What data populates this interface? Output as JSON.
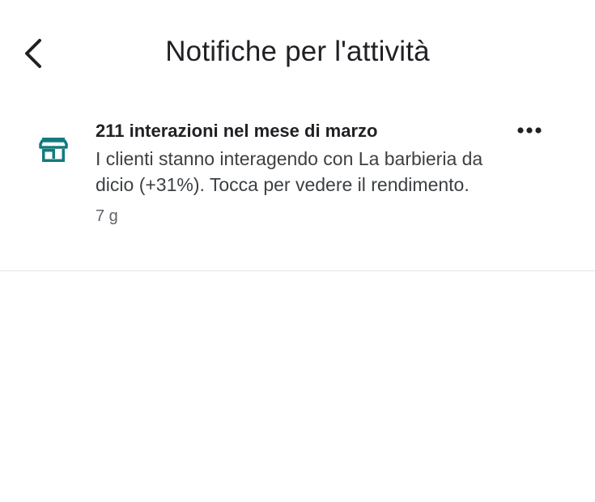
{
  "header": {
    "title": "Notifiche per l'attività",
    "back_icon": "chevron-left-icon"
  },
  "notification": {
    "icon": "storefront-icon",
    "icon_color": "#137b7f",
    "title": "211 interazioni nel mese di marzo",
    "text": "I clienti stanno interagendo con La barbieria da dicio (+31%). Tocca per vedere il rendimento.",
    "time": "7 g",
    "more_icon": "more-horiz-icon"
  }
}
